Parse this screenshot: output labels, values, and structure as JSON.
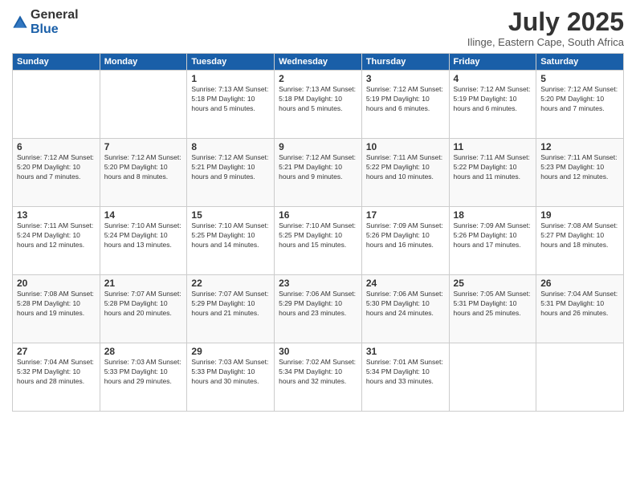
{
  "logo": {
    "general": "General",
    "blue": "Blue"
  },
  "title": "July 2025",
  "location": "Ilinge, Eastern Cape, South Africa",
  "days_of_week": [
    "Sunday",
    "Monday",
    "Tuesday",
    "Wednesday",
    "Thursday",
    "Friday",
    "Saturday"
  ],
  "weeks": [
    [
      {
        "day": "",
        "info": ""
      },
      {
        "day": "",
        "info": ""
      },
      {
        "day": "1",
        "info": "Sunrise: 7:13 AM\nSunset: 5:18 PM\nDaylight: 10 hours and 5 minutes."
      },
      {
        "day": "2",
        "info": "Sunrise: 7:13 AM\nSunset: 5:18 PM\nDaylight: 10 hours and 5 minutes."
      },
      {
        "day": "3",
        "info": "Sunrise: 7:12 AM\nSunset: 5:19 PM\nDaylight: 10 hours and 6 minutes."
      },
      {
        "day": "4",
        "info": "Sunrise: 7:12 AM\nSunset: 5:19 PM\nDaylight: 10 hours and 6 minutes."
      },
      {
        "day": "5",
        "info": "Sunrise: 7:12 AM\nSunset: 5:20 PM\nDaylight: 10 hours and 7 minutes."
      }
    ],
    [
      {
        "day": "6",
        "info": "Sunrise: 7:12 AM\nSunset: 5:20 PM\nDaylight: 10 hours and 7 minutes."
      },
      {
        "day": "7",
        "info": "Sunrise: 7:12 AM\nSunset: 5:20 PM\nDaylight: 10 hours and 8 minutes."
      },
      {
        "day": "8",
        "info": "Sunrise: 7:12 AM\nSunset: 5:21 PM\nDaylight: 10 hours and 9 minutes."
      },
      {
        "day": "9",
        "info": "Sunrise: 7:12 AM\nSunset: 5:21 PM\nDaylight: 10 hours and 9 minutes."
      },
      {
        "day": "10",
        "info": "Sunrise: 7:11 AM\nSunset: 5:22 PM\nDaylight: 10 hours and 10 minutes."
      },
      {
        "day": "11",
        "info": "Sunrise: 7:11 AM\nSunset: 5:22 PM\nDaylight: 10 hours and 11 minutes."
      },
      {
        "day": "12",
        "info": "Sunrise: 7:11 AM\nSunset: 5:23 PM\nDaylight: 10 hours and 12 minutes."
      }
    ],
    [
      {
        "day": "13",
        "info": "Sunrise: 7:11 AM\nSunset: 5:24 PM\nDaylight: 10 hours and 12 minutes."
      },
      {
        "day": "14",
        "info": "Sunrise: 7:10 AM\nSunset: 5:24 PM\nDaylight: 10 hours and 13 minutes."
      },
      {
        "day": "15",
        "info": "Sunrise: 7:10 AM\nSunset: 5:25 PM\nDaylight: 10 hours and 14 minutes."
      },
      {
        "day": "16",
        "info": "Sunrise: 7:10 AM\nSunset: 5:25 PM\nDaylight: 10 hours and 15 minutes."
      },
      {
        "day": "17",
        "info": "Sunrise: 7:09 AM\nSunset: 5:26 PM\nDaylight: 10 hours and 16 minutes."
      },
      {
        "day": "18",
        "info": "Sunrise: 7:09 AM\nSunset: 5:26 PM\nDaylight: 10 hours and 17 minutes."
      },
      {
        "day": "19",
        "info": "Sunrise: 7:08 AM\nSunset: 5:27 PM\nDaylight: 10 hours and 18 minutes."
      }
    ],
    [
      {
        "day": "20",
        "info": "Sunrise: 7:08 AM\nSunset: 5:28 PM\nDaylight: 10 hours and 19 minutes."
      },
      {
        "day": "21",
        "info": "Sunrise: 7:07 AM\nSunset: 5:28 PM\nDaylight: 10 hours and 20 minutes."
      },
      {
        "day": "22",
        "info": "Sunrise: 7:07 AM\nSunset: 5:29 PM\nDaylight: 10 hours and 21 minutes."
      },
      {
        "day": "23",
        "info": "Sunrise: 7:06 AM\nSunset: 5:29 PM\nDaylight: 10 hours and 23 minutes."
      },
      {
        "day": "24",
        "info": "Sunrise: 7:06 AM\nSunset: 5:30 PM\nDaylight: 10 hours and 24 minutes."
      },
      {
        "day": "25",
        "info": "Sunrise: 7:05 AM\nSunset: 5:31 PM\nDaylight: 10 hours and 25 minutes."
      },
      {
        "day": "26",
        "info": "Sunrise: 7:04 AM\nSunset: 5:31 PM\nDaylight: 10 hours and 26 minutes."
      }
    ],
    [
      {
        "day": "27",
        "info": "Sunrise: 7:04 AM\nSunset: 5:32 PM\nDaylight: 10 hours and 28 minutes."
      },
      {
        "day": "28",
        "info": "Sunrise: 7:03 AM\nSunset: 5:33 PM\nDaylight: 10 hours and 29 minutes."
      },
      {
        "day": "29",
        "info": "Sunrise: 7:03 AM\nSunset: 5:33 PM\nDaylight: 10 hours and 30 minutes."
      },
      {
        "day": "30",
        "info": "Sunrise: 7:02 AM\nSunset: 5:34 PM\nDaylight: 10 hours and 32 minutes."
      },
      {
        "day": "31",
        "info": "Sunrise: 7:01 AM\nSunset: 5:34 PM\nDaylight: 10 hours and 33 minutes."
      },
      {
        "day": "",
        "info": ""
      },
      {
        "day": "",
        "info": ""
      }
    ]
  ]
}
